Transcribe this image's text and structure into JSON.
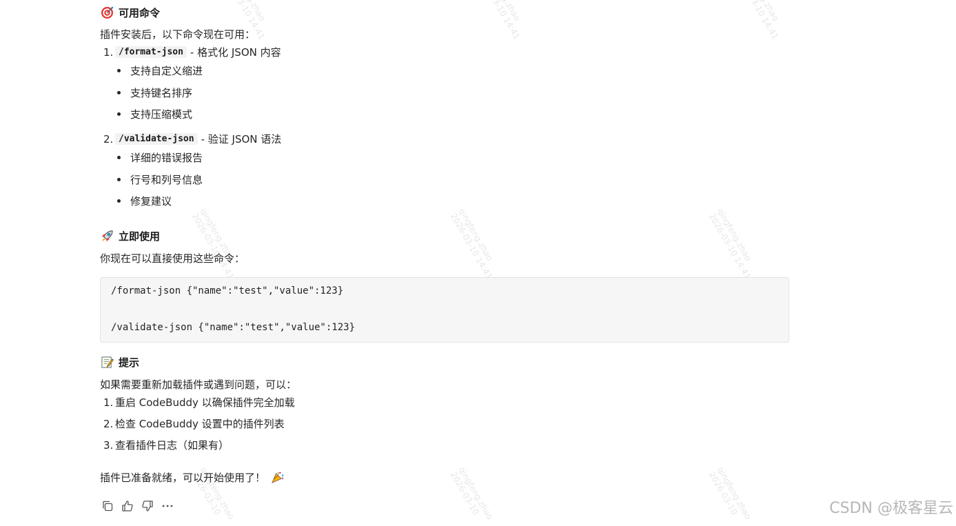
{
  "watermark": {
    "user": "qingfeng.zhao",
    "date": "2026-03-10 14:41",
    "date_short": "2026-03-10"
  },
  "section_commands": {
    "emoji": "target-icon",
    "title": "可用命令",
    "intro": "插件安装后，以下命令现在可用：",
    "items": [
      {
        "num": "1.",
        "code": "/format-json",
        "desc": "- 格式化 JSON 内容",
        "bullets": [
          "支持自定义缩进",
          "支持键名排序",
          "支持压缩模式"
        ]
      },
      {
        "num": "2.",
        "code": "/validate-json",
        "desc": "- 验证 JSON 语法",
        "bullets": [
          "详细的错误报告",
          "行号和列号信息",
          "修复建议"
        ]
      }
    ]
  },
  "section_usage": {
    "emoji": "rocket-icon",
    "title": "立即使用",
    "intro": "你现在可以直接使用这些命令：",
    "code_lines": [
      "/format-json {\"name\":\"test\",\"value\":123}",
      "/validate-json {\"name\":\"test\",\"value\":123}"
    ]
  },
  "section_tips": {
    "emoji": "memo-icon",
    "title": "提示",
    "intro": "如果需要重新加载插件或遇到问题，可以：",
    "items": [
      {
        "num": "1.",
        "text": "重启 CodeBuddy 以确保插件完全加载"
      },
      {
        "num": "2.",
        "text": "检查 CodeBuddy 设置中的插件列表"
      },
      {
        "num": "3.",
        "text": "查看插件日志（如果有）"
      }
    ]
  },
  "closing": {
    "text": "插件已准备就绪，可以开始使用了！",
    "emoji": "party-popper-icon"
  },
  "actions": [
    {
      "icon": "copy-icon"
    },
    {
      "icon": "thumbs-up-icon"
    },
    {
      "icon": "thumbs-down-icon"
    },
    {
      "icon": "more-icon"
    }
  ],
  "brand": "CSDN @极客星云",
  "colors": {
    "text": "#262626",
    "code_bg": "#f6f6f6",
    "watermark": "#d3d3d3",
    "brand": "#b6b6b6"
  }
}
